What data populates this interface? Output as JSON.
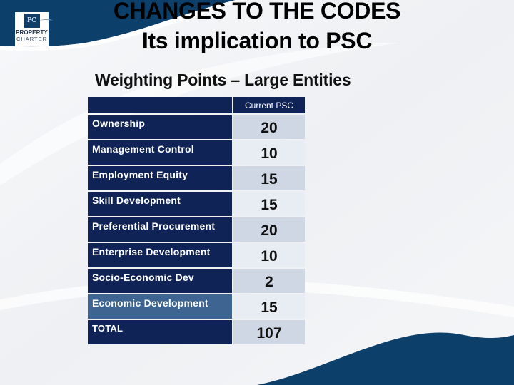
{
  "slide": {
    "title_line1": "CHANGES TO THE CODES",
    "title_line2": "Its implication to PSC",
    "subtitle": "Weighting Points – Large Entities"
  },
  "logo": {
    "mark": "PC",
    "line1": "PROPERTY",
    "line2": "CHARTER"
  },
  "colors": {
    "header_blue": "#0d3f6b",
    "table_dark": "#0f2357",
    "table_light": "#3e6592",
    "cell_odd": "#cfd7e5",
    "cell_even": "#e8ecf3"
  },
  "table": {
    "column_header": "Current PSC",
    "rows": [
      {
        "label": "Ownership",
        "value": "20"
      },
      {
        "label": "Management Control",
        "value": "10"
      },
      {
        "label": "Employment Equity",
        "value": "15"
      },
      {
        "label": "Skill Development",
        "value": "15"
      },
      {
        "label": "Preferential Procurement",
        "value": "20"
      },
      {
        "label": "Enterprise  Development",
        "value": "10"
      },
      {
        "label": "Socio-Economic Dev",
        "value": "2"
      },
      {
        "label": "Economic Development",
        "value": "15"
      },
      {
        "label": "TOTAL",
        "value": "107"
      }
    ]
  }
}
